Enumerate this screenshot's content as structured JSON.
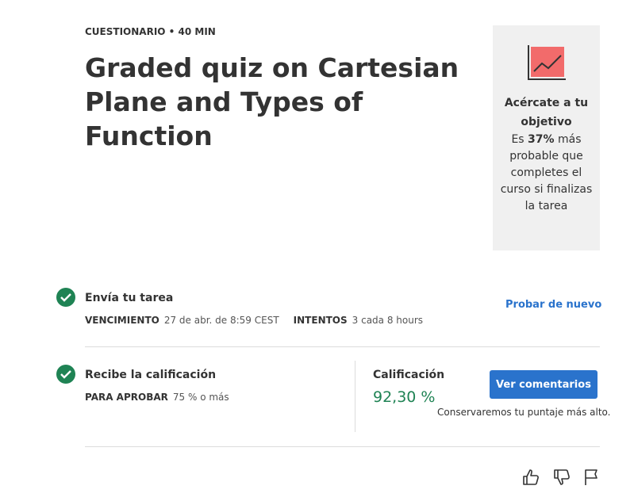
{
  "header": {
    "eyebrow": "CUESTIONARIO • 40 MIN",
    "title": "Graded quiz on Cartesian Plane and Types of Function"
  },
  "goal_card": {
    "icon": "trend-chart-icon",
    "heading": "Acércate a tu objetivo",
    "text_prefix": "Es ",
    "percent": "37%",
    "text_suffix": " más probable que completes el curso si finalizas la tarea"
  },
  "submit": {
    "title": "Envía tu tarea",
    "due_key": "VENCIMIENTO",
    "due_value": "27 de abr. de 8:59 CEST",
    "attempts_key": "INTENTOS",
    "attempts_value": "3 cada 8 hours",
    "retry_label": "Probar de nuevo"
  },
  "grade": {
    "title": "Recibe la calificación",
    "pass_key": "PARA APROBAR",
    "pass_value": "75 % o más",
    "grade_label": "Calificación",
    "grade_value": "92,30 %",
    "feedback_label": "Ver comentarios",
    "note": "Conservaremos tu puntaje más alto."
  },
  "footer_icons": [
    "thumbs-up-icon",
    "thumbs-down-icon",
    "flag-icon"
  ],
  "colors": {
    "accent": "#2a73cc",
    "success": "#1f8354",
    "card_bg": "#f0f0f0",
    "chart_red": "#f26b6b"
  }
}
